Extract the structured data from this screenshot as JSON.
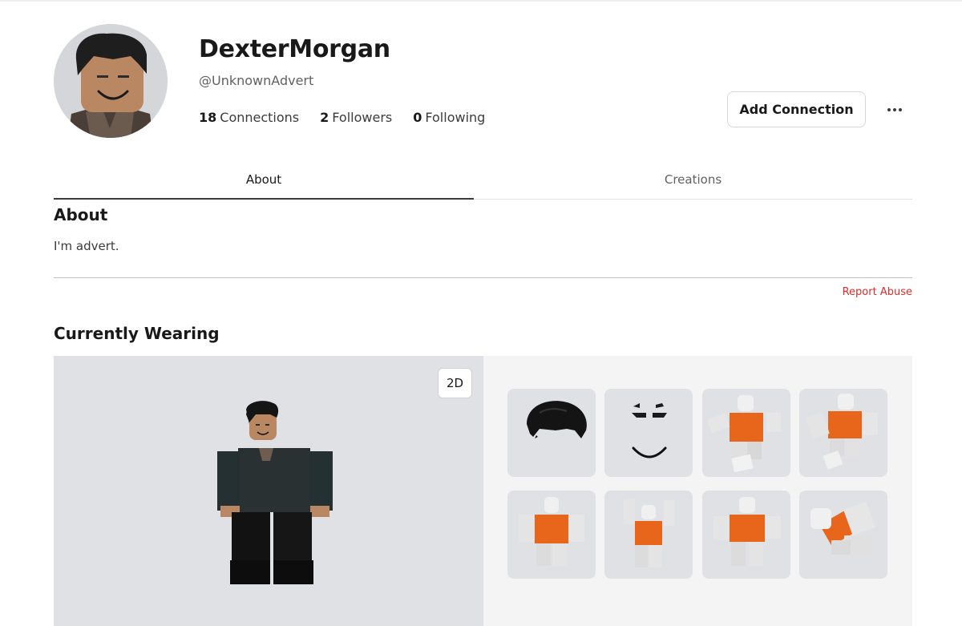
{
  "profile": {
    "display_name": "DexterMorgan",
    "username": "@UnknownAdvert",
    "stats": [
      {
        "count": "18",
        "label": "Connections"
      },
      {
        "count": "2",
        "label": "Followers"
      },
      {
        "count": "0",
        "label": "Following"
      }
    ],
    "add_connection_label": "Add Connection",
    "more_icon": "ellipsis-icon"
  },
  "tabs": [
    {
      "label": "About",
      "active": true
    },
    {
      "label": "Creations",
      "active": false
    }
  ],
  "about": {
    "title": "About",
    "text": "I'm advert.",
    "report_label": "Report Abuse"
  },
  "wearing": {
    "title": "Currently Wearing",
    "view_toggle_label": "2D",
    "items": [
      {
        "icon": "hair-item"
      },
      {
        "icon": "face-item"
      },
      {
        "icon": "animation-pose-item"
      },
      {
        "icon": "animation-pose-item"
      },
      {
        "icon": "animation-pose-item"
      },
      {
        "icon": "animation-pose-item"
      },
      {
        "icon": "animation-pose-item"
      },
      {
        "icon": "animation-pose-item"
      }
    ]
  },
  "colors": {
    "accent_red": "#d92d2d",
    "item_orange": "#e8661c",
    "tile_bg": "#dfe1e4"
  }
}
